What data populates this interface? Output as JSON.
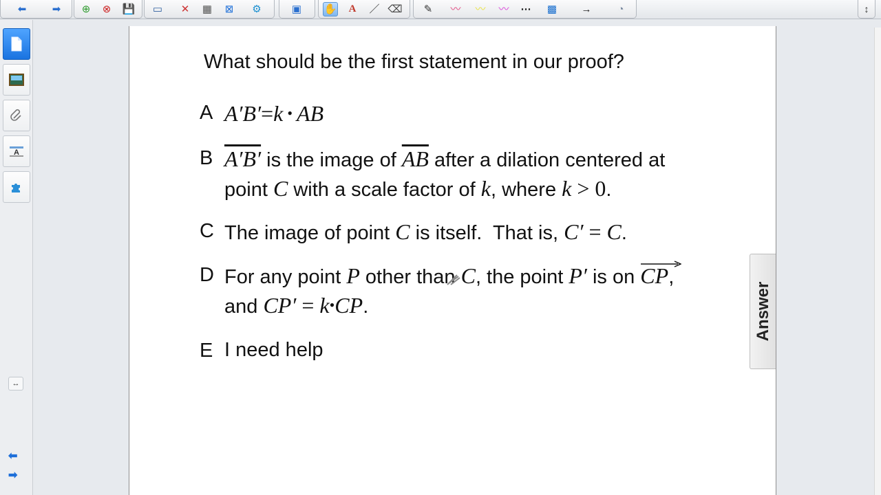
{
  "toolbar": {
    "items": [
      {
        "name": "back-icon",
        "glyph": "⬅"
      },
      {
        "name": "forward-icon",
        "glyph": "➡"
      },
      {
        "name": "add-page-icon",
        "glyph": "⊕"
      },
      {
        "name": "delete-page-icon",
        "glyph": "⊗"
      },
      {
        "name": "save-icon",
        "glyph": "💾"
      },
      {
        "name": "screen-shade-icon",
        "glyph": "▭"
      },
      {
        "name": "delete-icon",
        "glyph": "✕"
      },
      {
        "name": "table-icon",
        "glyph": "▦"
      },
      {
        "name": "close-box-icon",
        "glyph": "⊠"
      },
      {
        "name": "settings-icon",
        "glyph": "⚙"
      },
      {
        "name": "display-icon",
        "glyph": "▣"
      },
      {
        "name": "select-tool-icon",
        "glyph": "✋"
      },
      {
        "name": "text-tool-icon",
        "glyph": "A"
      },
      {
        "name": "line-tool-icon",
        "glyph": "／"
      },
      {
        "name": "eraser-icon",
        "glyph": "⌫"
      },
      {
        "name": "pen-icon",
        "glyph": "✎"
      },
      {
        "name": "pen-pink-icon",
        "glyph": "〰"
      },
      {
        "name": "highlighter-yellow-icon",
        "glyph": "〰"
      },
      {
        "name": "pen-magenta-icon",
        "glyph": "〰"
      },
      {
        "name": "pen-dots-icon",
        "glyph": "⋯"
      },
      {
        "name": "color-fill-icon",
        "glyph": "▩"
      },
      {
        "name": "arrow-tool-icon",
        "glyph": "→"
      },
      {
        "name": "properties-icon",
        "glyph": "◔"
      }
    ],
    "collapse_glyph": "↕"
  },
  "colors": {
    "accent": "#1a73e0",
    "page": "#ffffff",
    "text": "#111111",
    "scribble": "#777777"
  },
  "question": "What should be the first statement in our proof?",
  "options": {
    "a": {
      "letter": "A",
      "eq1": "A′B′",
      "eq2": "=",
      "eq3": "k",
      "eq4": "•",
      "eq5": "AB"
    },
    "b": {
      "letter": "B",
      "seg1": "A′B′",
      "t1": " is the image of ",
      "seg2": "AB",
      "t2": " after a dilation centered at",
      "t3": "point ",
      "pt": "C",
      "t4": " with a scale factor of ",
      "k1": "k",
      "t5": ", where ",
      "k2": "k",
      "gt": " > ",
      "zero": "0",
      "t6": "."
    },
    "c": {
      "letter": "C",
      "t1": "The image of point ",
      "pt": "C",
      "t2": " is itself.  That is, ",
      "eqL": "C′",
      "eqM": " = ",
      "eqR": "C",
      "t3": "."
    },
    "d": {
      "letter": "D",
      "t1": "For any point ",
      "p": "P",
      "t2": " other than ",
      "c": "C",
      "t3": ", the point ",
      "pp": "P′",
      "t4": " is on ",
      "ray": "CP",
      "t5": ",",
      "t6": "and ",
      "cpp": "CP′",
      "eq": " = ",
      "k": "k",
      "dot": "•",
      "cp": "CP",
      "t7": "."
    },
    "e": {
      "letter": "E",
      "text": "I need help"
    }
  },
  "answer_tab": "Answer"
}
